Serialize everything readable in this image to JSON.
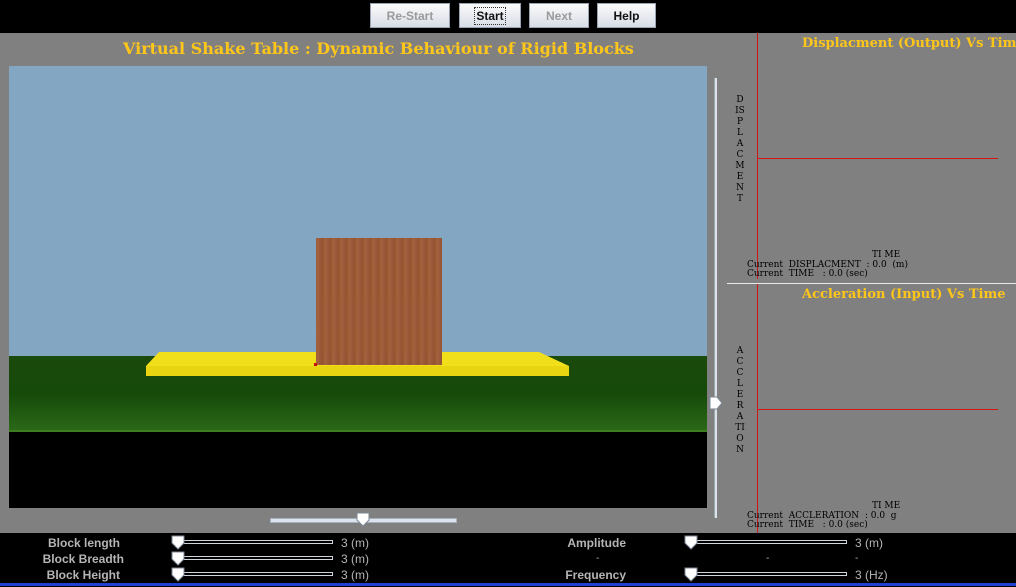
{
  "toolbar": {
    "restart_label": "Re-Start",
    "start_label": "Start",
    "next_label": "Next",
    "help_label": "Help"
  },
  "main": {
    "title": "Virtual Shake Table : Dynamic Behaviour of Rigid Blocks"
  },
  "graphs": {
    "displacement": {
      "title": "Displacment (Output) Vs Time",
      "y_label": "DISPLACMENT",
      "x_label": "TI ME",
      "current_value_line": "Current  DISPLACMENT  : 0.0  (m)",
      "current_time_line": "Current  TIME   : 0.0 (sec)"
    },
    "acceleration": {
      "title": "Accleration (Input) Vs Time",
      "y_label": "ACCLERATION",
      "x_label": "TI ME",
      "current_value_line": "Current  ACCLERATION  : 0.0  g",
      "current_time_line": "Current  TIME   : 0.0 (sec)"
    }
  },
  "controls": {
    "block_length": {
      "label": "Block length",
      "value": "3 (m)",
      "level": 0.0
    },
    "block_breadth": {
      "label": "Block Breadth",
      "value": "3 (m)",
      "level": 0.0
    },
    "block_height": {
      "label": "Block Height",
      "value": "3 (m)",
      "level": 0.0
    },
    "amplitude": {
      "label": "Amplitude",
      "value": "3 (m)",
      "level": 0.0
    },
    "frequency": {
      "label": "Frequency",
      "value": "3 (Hz)",
      "level": 0.0
    },
    "separator_marks": [
      "-",
      "-",
      "-"
    ]
  },
  "colors": {
    "title": "#ffc61a",
    "sky": "#83a7c2",
    "ground": "#1f4f10",
    "table": "#f2df1c",
    "block": "#9e5a37",
    "axis": "#d01515"
  },
  "icons": {
    "slider_thumb": "slider-thumb-icon",
    "slider_thumb_right": "slider-thumb-right-icon"
  }
}
